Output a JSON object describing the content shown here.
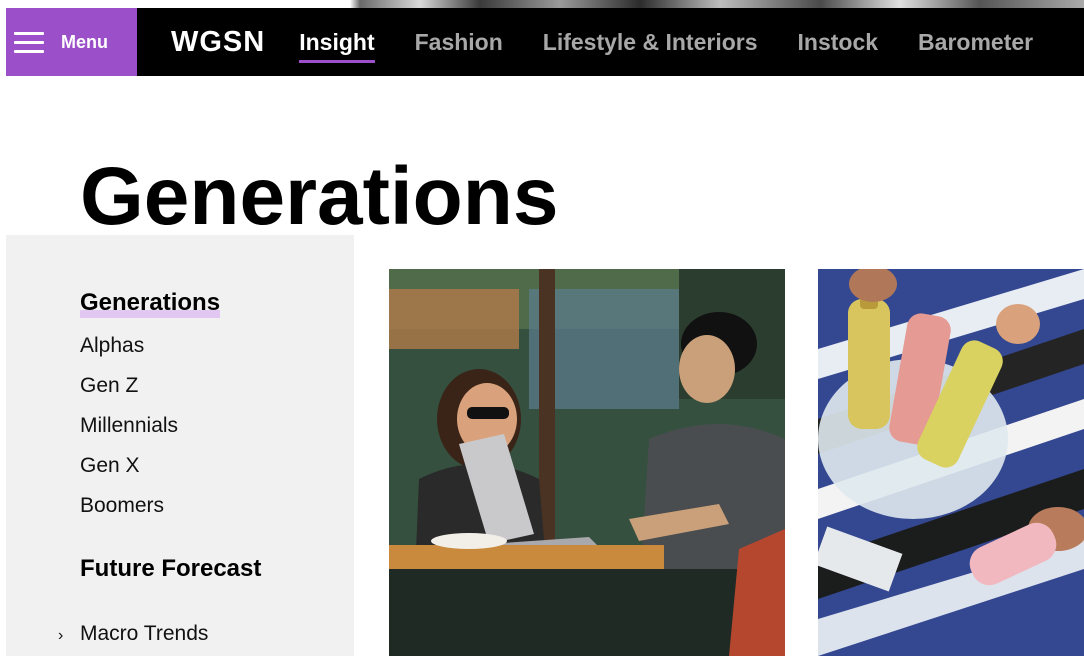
{
  "navbar": {
    "menu_label": "Menu",
    "logo": "WGSN",
    "items": [
      {
        "label": "Insight",
        "active": true
      },
      {
        "label": "Fashion",
        "active": false
      },
      {
        "label": "Lifestyle & Interiors",
        "active": false
      },
      {
        "label": "Instock",
        "active": false
      },
      {
        "label": "Barometer",
        "active": false
      }
    ]
  },
  "page": {
    "title": "Generations"
  },
  "sidebar": {
    "section1_heading": "Generations",
    "section1_items": [
      "Alphas",
      "Gen Z",
      "Millennials",
      "Gen X",
      "Boomers"
    ],
    "section2_heading": "Future Forecast",
    "section2_items": [
      {
        "label": "Macro Trends",
        "icon": "chevron-right-icon"
      }
    ]
  },
  "colors": {
    "accent": "#9b4fc9",
    "navbar_bg": "#000000",
    "sidebar_bg": "#f1f1f1"
  }
}
